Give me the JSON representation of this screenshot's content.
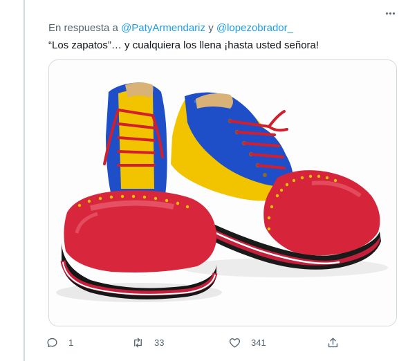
{
  "reply": {
    "prefix": "En respuesta a",
    "mention1": "@PatyArmendariz",
    "connector": "y",
    "mention2": "@lopezobrador_"
  },
  "tweet": {
    "text": "“Los zapatos”… y cualquiera los llena ¡hasta usted señora!"
  },
  "media": {
    "alt": "Un par de zapatos de payaso rojos, azules y amarillos con agujetas rojas"
  },
  "actions": {
    "replies": "1",
    "retweets": "33",
    "likes": "341"
  },
  "icons": {
    "more": "more-horizontal-icon",
    "reply": "reply-bubble-icon",
    "retweet": "retweet-icon",
    "like": "heart-icon",
    "share": "share-icon"
  },
  "colors": {
    "link": "#1d9bf0",
    "muted": "#536471",
    "border": "#cfd9de"
  }
}
